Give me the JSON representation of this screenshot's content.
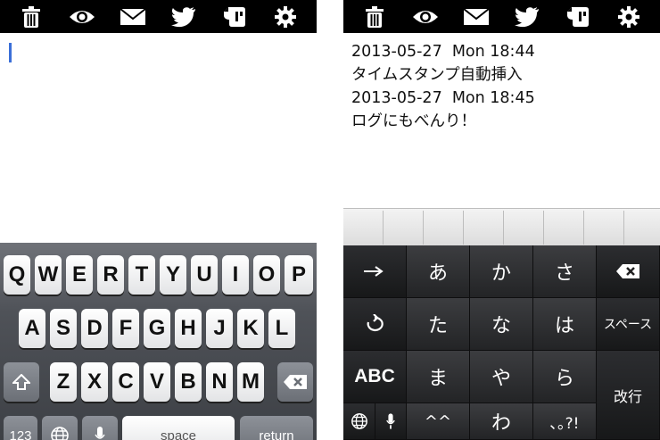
{
  "toolbar_icons": [
    "trash-icon",
    "eye-icon",
    "mail-icon",
    "twitter-icon",
    "evernote-icon",
    "gear-icon"
  ],
  "right_editor": {
    "lines": [
      "2013-05-27  Mon 18:44",
      "タイムスタンプ自動挿入",
      "2013-05-27  Mon 18:45",
      "ログにもべんり！"
    ]
  },
  "keyboard_en": {
    "row1": [
      "Q",
      "W",
      "E",
      "R",
      "T",
      "Y",
      "U",
      "I",
      "O",
      "P"
    ],
    "row2": [
      "A",
      "S",
      "D",
      "F",
      "G",
      "H",
      "J",
      "K",
      "L"
    ],
    "row3": [
      "Z",
      "X",
      "C",
      "V",
      "B",
      "N",
      "M"
    ],
    "numbers_label": "123",
    "space_label": "space",
    "return_label": "return"
  },
  "keyboard_ja": {
    "row1": [
      "あ",
      "か",
      "さ"
    ],
    "row2": [
      "た",
      "な",
      "は"
    ],
    "row3": [
      "ま",
      "や",
      "ら"
    ],
    "row4": [
      "^^",
      "わ",
      "､｡?!"
    ],
    "abc_label": "ABC",
    "space_label": "スペース",
    "enter_label": "改行"
  },
  "colors": {
    "toolbar": "#000000",
    "cursor": "#3b6fd8",
    "ja_keyboard": "#1d1e20"
  }
}
